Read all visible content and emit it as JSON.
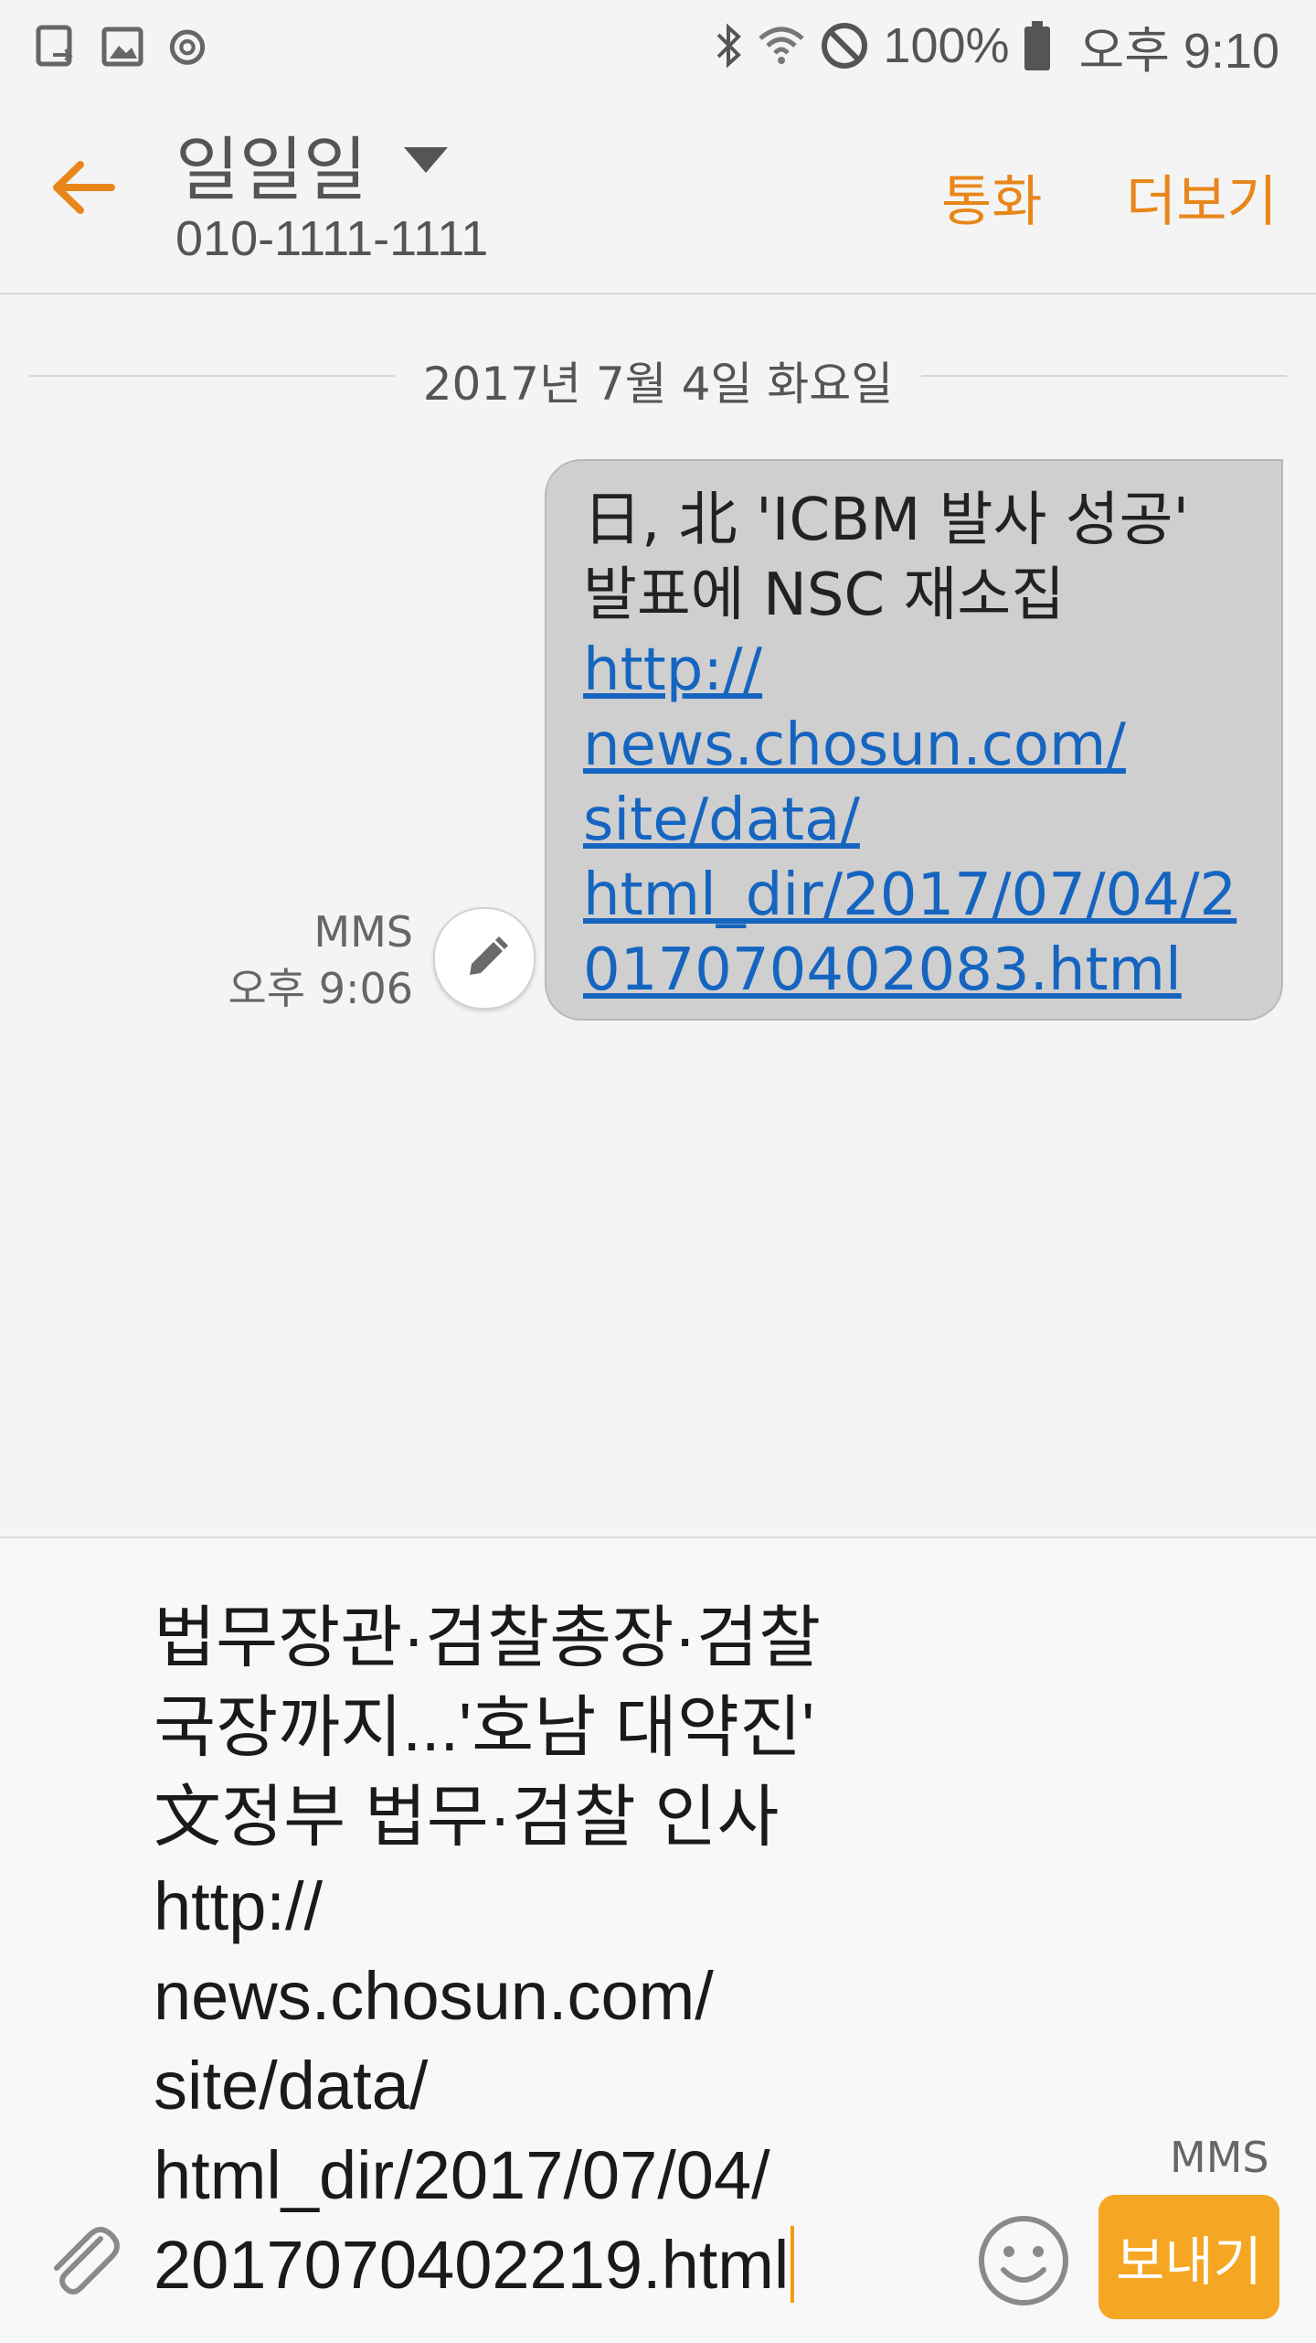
{
  "status_bar": {
    "battery": "100%",
    "time": "오후 9:10",
    "icons": [
      "screen-share-icon",
      "gallery-icon",
      "sync-icon",
      "bluetooth-icon",
      "wifi-icon",
      "do-not-disturb-icon",
      "battery-icon"
    ]
  },
  "header": {
    "contact_name": "일일일",
    "contact_number": "010-1111-1111",
    "call_label": "통화",
    "more_label": "더보기",
    "accent_color": "#e8861a"
  },
  "conversation": {
    "date": "2017년 7월 4일 화요일",
    "messages": [
      {
        "text_line1": "日, 北 'ICBM 발사 성공'",
        "text_line2": "발표에 NSC 재소집",
        "link_lines": [
          "http://",
          "news.chosun.com/",
          "site/data/",
          "html_dir/2017/07/04/2",
          "017070402083.html"
        ],
        "type": "MMS",
        "time": "오후 9:06"
      }
    ]
  },
  "composer": {
    "text": "법무장관·검찰총장·검찰\n국장까지...'호남 대약진'\n文정부 법무·검찰 인사\nhttp://\nnews.chosun.com/\nsite/data/\nhtml_dir/2017/07/04/\n2017070402219.html",
    "mms_label": "MMS",
    "send_label": "보내기",
    "send_color": "#f5a623"
  }
}
